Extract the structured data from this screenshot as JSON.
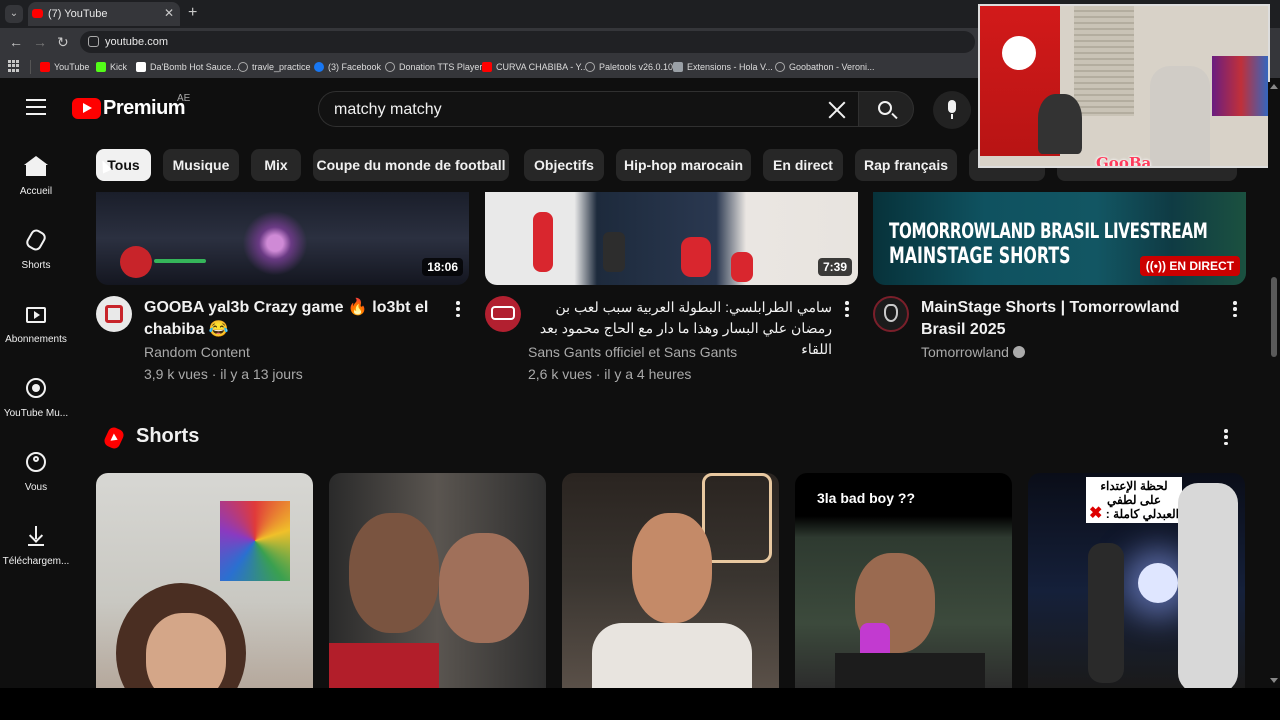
{
  "browser": {
    "tab_title": "(7) YouTube",
    "url": "youtube.com",
    "bookmarks": [
      {
        "label": "YouTube",
        "color": "#ff0000"
      },
      {
        "label": "Kick",
        "color": "#53fc18"
      },
      {
        "label": "Da'Bomb Hot Sauce...",
        "color": "#ffffff"
      },
      {
        "label": "travle_practice",
        "color": "#9aa0a6"
      },
      {
        "label": "(3) Facebook",
        "color": "#1877f2"
      },
      {
        "label": "Donation TTS Player",
        "color": "#9aa0a6"
      },
      {
        "label": "CURVA CHABIBA - Y...",
        "color": "#ff0000"
      },
      {
        "label": "Paletools v26.0.10",
        "color": "#9aa0a6"
      },
      {
        "label": "Extensions - Hola V...",
        "color": "#9aa0a6"
      },
      {
        "label": "Goobathon - Veroni...",
        "color": "#9aa0a6"
      }
    ]
  },
  "header": {
    "logo_text": "Premium",
    "country_code": "AE",
    "search_value": "matchy matchy",
    "brand_color": "#ff0000"
  },
  "chips": [
    "Tous",
    "Musique",
    "Mix",
    "Coupe du monde de football",
    "Objectifs",
    "Hip-hop marocain",
    "En direct",
    "Rap français"
  ],
  "sidebar": [
    {
      "label": "Accueil",
      "icon": "home-icon"
    },
    {
      "label": "Shorts",
      "icon": "shorts-icon"
    },
    {
      "label": "Abonnements",
      "icon": "subscriptions-icon"
    },
    {
      "label": "YouTube Mu...",
      "icon": "youtube-music-icon"
    },
    {
      "label": "Vous",
      "icon": "you-icon"
    },
    {
      "label": "Téléchargem...",
      "icon": "download-icon"
    }
  ],
  "videos": [
    {
      "title": "GOOBA yal3b Crazy game 🔥 lo3bt el chabiba 😂",
      "channel": "Random Content",
      "meta": "3,9 k vues · il y a 13 jours",
      "duration": "18:06"
    },
    {
      "title": "سامي الطرابلسي: البطولة العربية سبب لعب بن رمضان علي البسار وهذا ما دار مع الحاج محمود بعد اللقاء",
      "channel": "Sans Gants officiel et Sans Gants",
      "meta": "2,6 k vues · il y a 4 heures",
      "duration": "7:39"
    },
    {
      "title": "MainStage Shorts | Tomorrowland Brasil 2025",
      "channel": "Tomorrowland",
      "meta": "",
      "live_label": "EN DIRECT",
      "thumb_text_1": "TOMORROWLAND BRASIL LIVESTREAM",
      "thumb_text_2": "MAINSTAGE SHORTS"
    }
  ],
  "shorts": {
    "title": "Shorts",
    "items": [
      {
        "caption": ""
      },
      {
        "caption": ""
      },
      {
        "caption": ""
      },
      {
        "caption": "3la bad boy ??"
      },
      {
        "caption": "لحظة الإعتداء على لطفي العبدلي كاملة :"
      }
    ]
  },
  "webcam": {
    "streamer_name": "GooBa"
  }
}
